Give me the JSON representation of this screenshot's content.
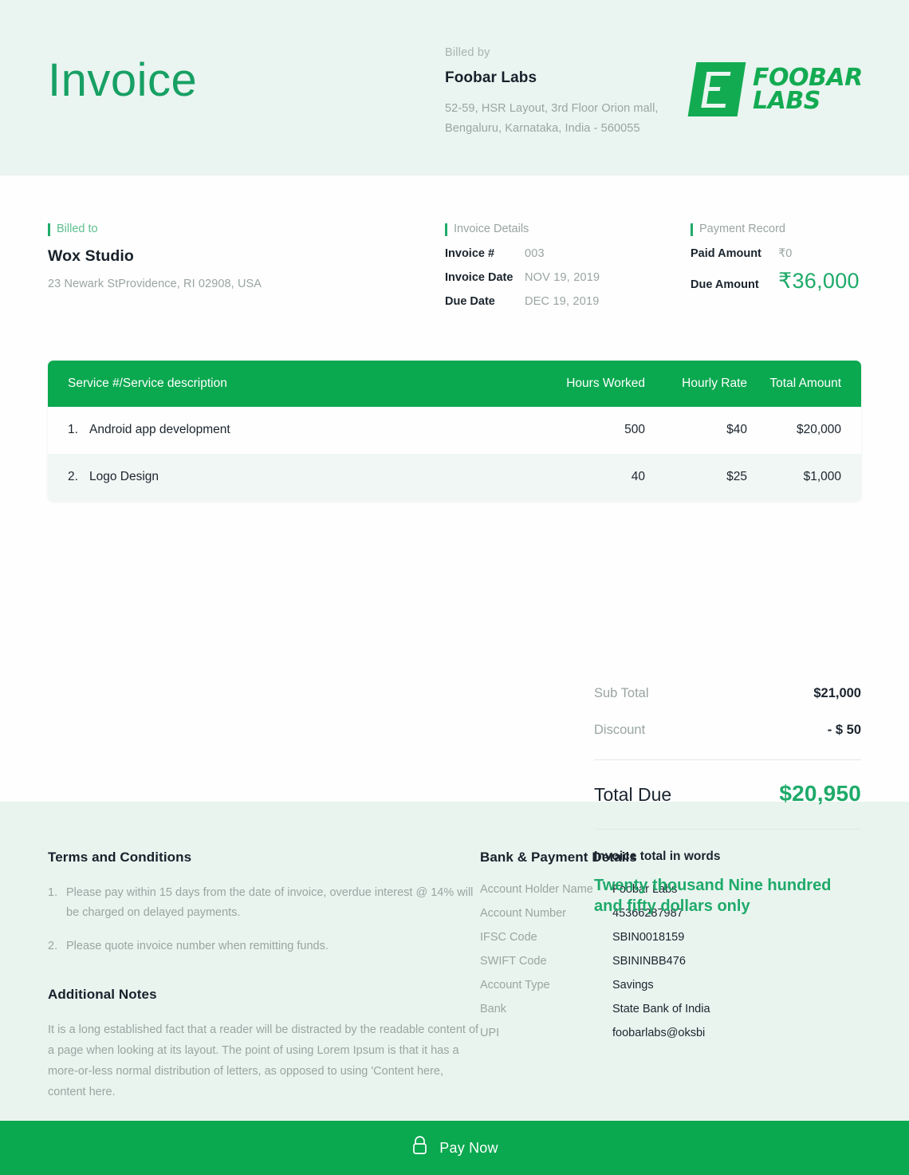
{
  "header": {
    "title": "Invoice",
    "billed_by_label": "Billed by",
    "company_name": "Foobar Labs",
    "address_line1": "52-59, HSR Layout, 3rd Floor Orion mall,",
    "address_line2": "Bengaluru, Karnataka, India - 560055",
    "logo_text_line1": "FOOBAR",
    "logo_text_line2": "LABS"
  },
  "billed_to": {
    "label": "Billed to",
    "name": "Wox Studio",
    "address": "23 Newark StProvidence, RI 02908, USA"
  },
  "invoice_details": {
    "label": "Invoice Details",
    "rows": [
      {
        "key": "Invoice #",
        "value": "003"
      },
      {
        "key": "Invoice Date",
        "value": "NOV 19, 2019"
      },
      {
        "key": "Due Date",
        "value": "DEC 19, 2019"
      }
    ]
  },
  "payment_record": {
    "label": "Payment Record",
    "paid_label": "Paid Amount",
    "paid_value": "₹0",
    "due_label": "Due Amount",
    "due_value": "₹36,000"
  },
  "table": {
    "columns": [
      "Service #/Service description",
      "Hours Worked",
      "Hourly Rate",
      "Total Amount"
    ],
    "rows": [
      {
        "num": "1.",
        "description": "Android app development",
        "hours": "500",
        "rate": "$40",
        "total": "$20,000"
      },
      {
        "num": "2.",
        "description": "Logo Design",
        "hours": "40",
        "rate": "$25",
        "total": "$1,000"
      }
    ]
  },
  "totals": {
    "subtotal_label": "Sub Total",
    "subtotal_value": "$21,000",
    "discount_label": "Discount",
    "discount_value": "- $ 50",
    "total_due_label": "Total Due",
    "total_due_value": "$20,950",
    "words_label": "Invoice total in words",
    "words_value": "Twenty thousand Nine hundred and fifty dollars only"
  },
  "terms": {
    "heading": "Terms and Conditions",
    "items": [
      {
        "num": "1.",
        "text": "Please pay within 15 days from the date of invoice, overdue interest @ 14% will be charged on delayed payments."
      },
      {
        "num": "2.",
        "text": "Please quote invoice number when remitting funds."
      }
    ],
    "notes_heading": "Additional Notes",
    "notes_text": "It is a long established fact that a reader will be distracted by the readable content of a page when looking at its layout. The point of using Lorem Ipsum is that it has a more-or-less normal distribution of letters, as opposed to using 'Content here, content here."
  },
  "bank": {
    "heading": "Bank & Payment Details",
    "rows": [
      {
        "key": "Account Holder Name",
        "value": "Foobar Labs"
      },
      {
        "key": "Account Number",
        "value": "45366287987"
      },
      {
        "key": "IFSC Code",
        "value": "SBIN0018159"
      },
      {
        "key": "SWIFT Code",
        "value": "SBININBB476"
      },
      {
        "key": "Account Type",
        "value": "Savings"
      },
      {
        "key": "Bank",
        "value": "State Bank of India"
      },
      {
        "key": "UPI",
        "value": "foobarlabs@oksbi"
      }
    ]
  },
  "paybar": {
    "label": "Pay Now",
    "icon": "lock-icon"
  },
  "colors": {
    "brand_green": "#0aa84f",
    "accent_green": "#1faa6a",
    "header_bg": "#eaf4f0",
    "footer_bg": "#e9f4ef",
    "muted_text": "#9aa5a2",
    "dark_text": "#1b242e"
  }
}
